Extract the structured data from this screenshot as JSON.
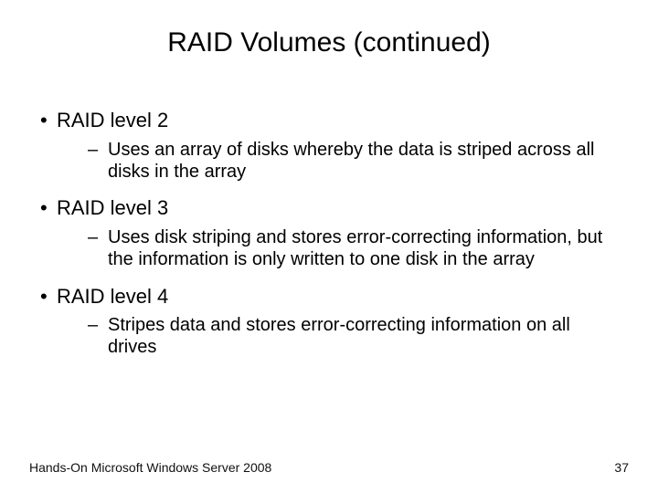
{
  "title": "RAID Volumes (continued)",
  "bullets": [
    {
      "label": "RAID level 2",
      "sub": "Uses an array of disks whereby the data is striped across all disks in the array"
    },
    {
      "label": "RAID level 3",
      "sub": "Uses disk striping and stores error-correcting information, but the information is only written to one disk in the array"
    },
    {
      "label": "RAID level 4",
      "sub": "Stripes data and stores error-correcting information on all drives"
    }
  ],
  "footer_left": "Hands-On Microsoft Windows Server 2008",
  "footer_right": "37",
  "glyphs": {
    "bullet": "•",
    "dash": "–"
  }
}
